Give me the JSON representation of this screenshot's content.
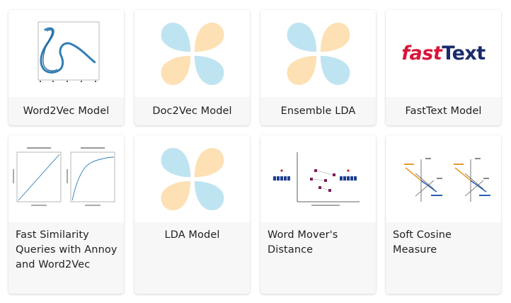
{
  "cards": [
    {
      "title": "Word2Vec Model",
      "thumb_icon": "word2vec-embedding-plot-icon"
    },
    {
      "title": "Doc2Vec Model",
      "thumb_icon": "petal-logo-icon"
    },
    {
      "title": "Ensemble LDA",
      "thumb_icon": "petal-logo-icon"
    },
    {
      "title": "FastText Model",
      "thumb_icon": "fasttext-logo-icon",
      "logo_text": [
        "fast",
        "Text"
      ]
    },
    {
      "title": "Fast Similarity Queries with Annoy and Word2Vec",
      "thumb_icon": "similarity-charts-icon"
    },
    {
      "title": "LDA Model",
      "thumb_icon": "petal-logo-icon"
    },
    {
      "title": "Word Mover's Distance",
      "thumb_icon": "word-movers-diagram-icon"
    },
    {
      "title": "Soft Cosine Measure",
      "thumb_icon": "soft-cosine-diagram-icon"
    }
  ],
  "colors": {
    "petal_blue": "#bfe4f1",
    "petal_orange": "#fde0b3",
    "fasttext_red": "#d8163a",
    "fasttext_navy": "#1a2b6b",
    "plot_blue": "#2f7eb5"
  }
}
